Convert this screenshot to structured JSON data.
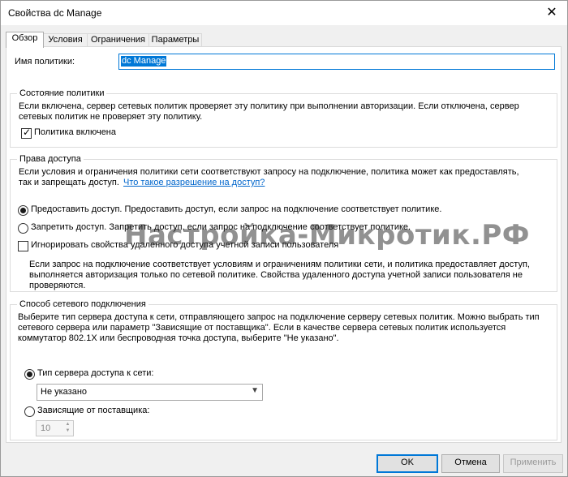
{
  "window": {
    "title": "Свойства dc Manage",
    "close_glyph": "✕"
  },
  "tabs": [
    {
      "label": "Обзор",
      "active": true
    },
    {
      "label": "Условия",
      "active": false
    },
    {
      "label": "Ограничения",
      "active": false
    },
    {
      "label": "Параметры",
      "active": false
    }
  ],
  "policy_name": {
    "label": "Имя политики:",
    "value": "dc Manage"
  },
  "state_group": {
    "title": "Состояние политики",
    "text1": "Если включена, сервер сетевых политик проверяет эту политику при выполнении авторизации. Если отключена, сервер",
    "text2": "сетевых политик не проверяет эту политику.",
    "checkbox_label": "Политика включена",
    "checked": true
  },
  "access_group": {
    "title": "Права доступа",
    "text1": "Если условия и ограничения политики сети соответствуют запросу на подключение, политика может как предоставлять,",
    "text2": "так и запрещать доступ.",
    "link": "Что такое разрешение на доступ?",
    "grant_label": "Предоставить доступ. Предоставить доступ, если запрос на подключение соответствует политике.",
    "deny_label": "Запретить доступ. Запретить доступ, если запрос на подключение соответствует политике.",
    "ignore_label": "Игнорировать свойства удаленного доступа учетной записи пользователя",
    "ignore_text1": "Если запрос на подключение соответствует условиям и ограничениям политики сети, и политика предоставляет доступ,",
    "ignore_text2": "выполняется авторизация только по сетевой политике. Свойства удаленного доступа учетной записи пользователя не",
    "ignore_text3": "проверяются."
  },
  "connection_group": {
    "title": "Способ сетевого подключения",
    "text1": "Выберите тип сервера доступа к сети, отправляющего запрос на подключение серверу сетевых политик. Можно выбрать тип",
    "text2": "сетевого сервера или параметр \"Зависящие от поставщика\". Если в качестве сервера сетевых политик используется",
    "text3": "коммутатор 802.1X или беспроводная точка доступа, выберите \"Не указано\".",
    "server_type_label": "Тип сервера доступа к сети:",
    "server_type_value": "Не указано",
    "vendor_label": "Зависящие от поставщика:",
    "vendor_value": "10"
  },
  "watermark": "Настройка-Микротик.РФ",
  "buttons": {
    "ok": "OK",
    "cancel": "Отмена",
    "apply": "Применить"
  }
}
